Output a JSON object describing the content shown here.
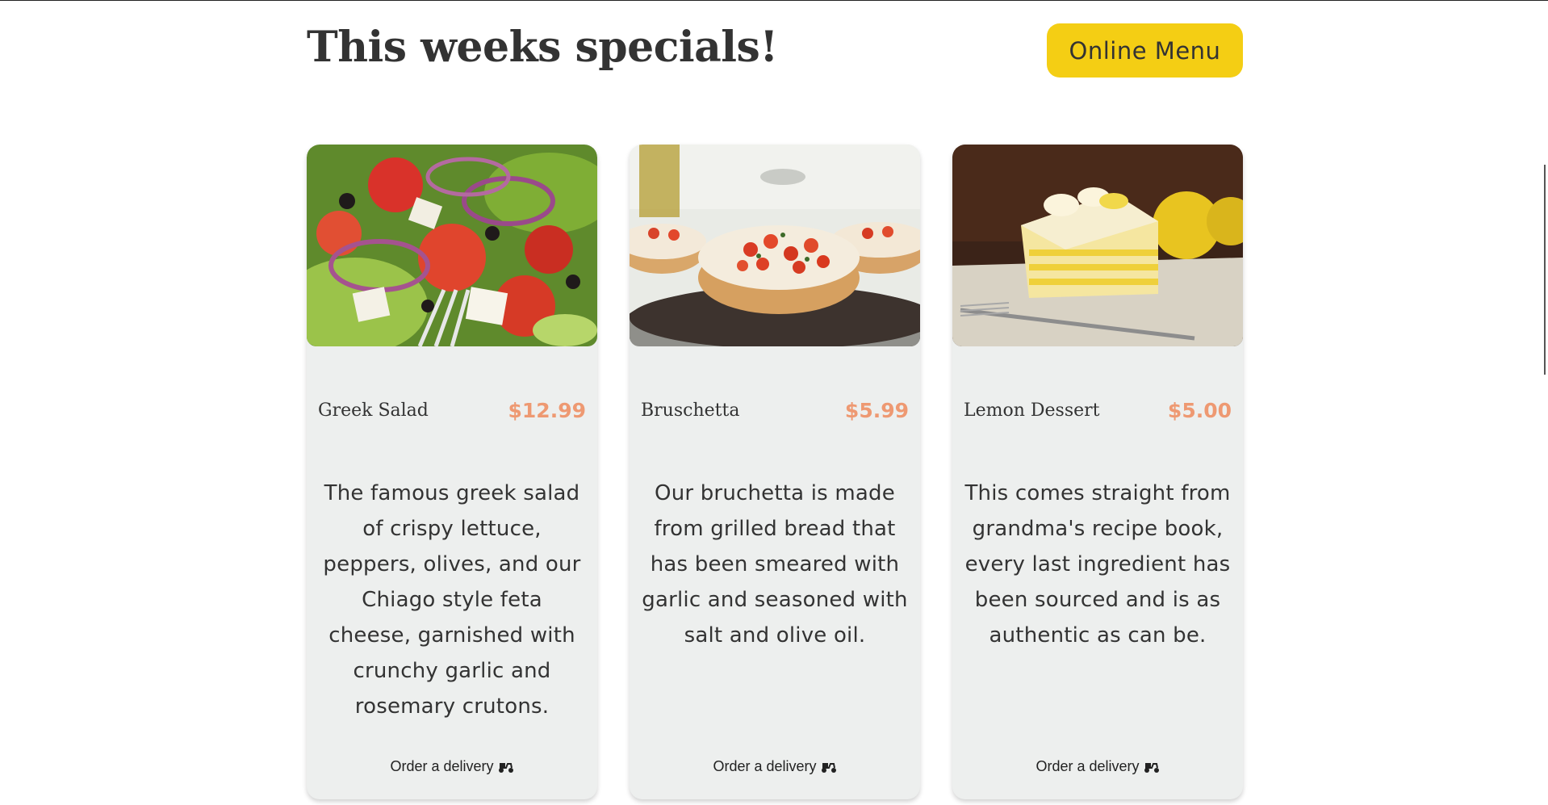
{
  "page": {
    "title": "This weeks specials!",
    "menu_button": "Online Menu"
  },
  "colors": {
    "accent_yellow": "#F4CE14",
    "price_salmon": "#EE9972",
    "card_bg": "#EDEFEE",
    "text_dark": "#333333"
  },
  "cards": [
    {
      "name": "Greek Salad",
      "price": "$12.99",
      "description": "The famous greek salad of crispy lettuce, peppers, olives, and our Chiago style feta cheese, garnished with crunchy garlic and rosemary crutons.",
      "order_label": "Order a delivery",
      "image": "greek-salad-photo",
      "icon": "scooter-icon"
    },
    {
      "name": "Bruschetta",
      "price": "$5.99",
      "description": "Our bruchetta is made from grilled bread that has been smeared with garlic and seasoned with salt and olive oil.",
      "order_label": "Order a delivery",
      "image": "bruschetta-photo",
      "icon": "scooter-icon"
    },
    {
      "name": "Lemon Dessert",
      "price": "$5.00",
      "description": "This comes straight from grandma's recipe book, every last ingredient has been sourced and is as authentic as can be.",
      "order_label": "Order a delivery",
      "image": "lemon-dessert-photo",
      "icon": "scooter-icon"
    }
  ]
}
